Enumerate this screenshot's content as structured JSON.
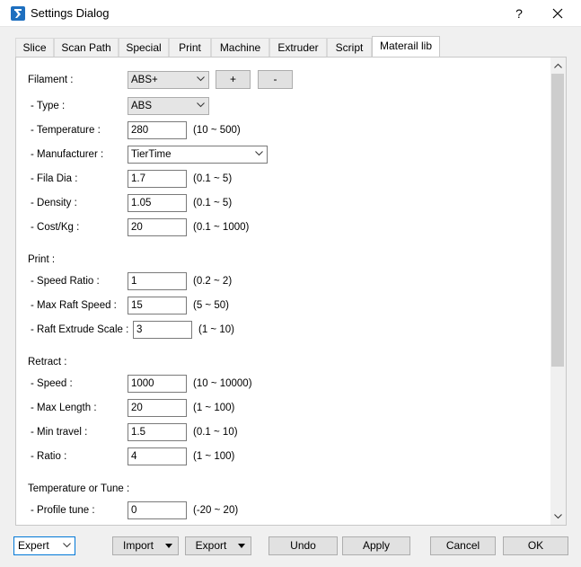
{
  "window": {
    "title": "Settings Dialog",
    "help": "?"
  },
  "tabs": [
    {
      "label": "Slice"
    },
    {
      "label": "Scan Path"
    },
    {
      "label": "Special"
    },
    {
      "label": "Print"
    },
    {
      "label": "Machine"
    },
    {
      "label": "Extruder"
    },
    {
      "label": "Script"
    },
    {
      "label": "Materail lib"
    }
  ],
  "active_tab": "Materail lib",
  "filament": {
    "label": "Filament :",
    "selected": "ABS+",
    "add_label": "+",
    "remove_label": "-",
    "type_label": "- Type :",
    "type_value": "ABS",
    "temperature": {
      "label": "- Temperature :",
      "value": "280",
      "range": "(10 ~ 500)"
    },
    "manufacturer": {
      "label": "- Manufacturer :",
      "value": "TierTime"
    },
    "fila_dia": {
      "label": "- Fila Dia :",
      "value": "1.7",
      "range": "(0.1 ~ 5)"
    },
    "density": {
      "label": "- Density :",
      "value": "1.05",
      "range": "(0.1 ~ 5)"
    },
    "cost": {
      "label": "- Cost/Kg :",
      "value": "20",
      "range": "(0.1 ~ 1000)"
    }
  },
  "print": {
    "label": "Print :",
    "speed_ratio": {
      "label": "- Speed Ratio :",
      "value": "1",
      "range": "(0.2 ~ 2)"
    },
    "max_raft_speed": {
      "label": "- Max Raft Speed :",
      "value": "15",
      "range": "(5 ~ 50)"
    },
    "raft_extrude_scale": {
      "label": "- Raft Extrude Scale :",
      "value": "3",
      "range": "(1 ~ 10)"
    }
  },
  "retract": {
    "label": "Retract :",
    "speed": {
      "label": "- Speed :",
      "value": "1000",
      "range": "(10 ~ 10000)"
    },
    "max_length": {
      "label": "- Max Length :",
      "value": "20",
      "range": "(1 ~ 100)"
    },
    "min_travel": {
      "label": "- Min travel :",
      "value": "1.5",
      "range": "(0.1 ~ 10)"
    },
    "ratio": {
      "label": "- Ratio :",
      "value": "4",
      "range": "(1 ~ 100)"
    }
  },
  "tune": {
    "label": "Temperature or Tune :",
    "profile_tune": {
      "label": "- Profile tune :",
      "value": "0",
      "range": "(-20 ~ 20)"
    }
  },
  "footer": {
    "mode": "Expert",
    "import": "Import",
    "export": "Export",
    "undo": "Undo",
    "apply": "Apply",
    "cancel": "Cancel",
    "ok": "OK"
  },
  "colors": {
    "accent": "#0078d7",
    "icon": "#1e6fbf"
  }
}
